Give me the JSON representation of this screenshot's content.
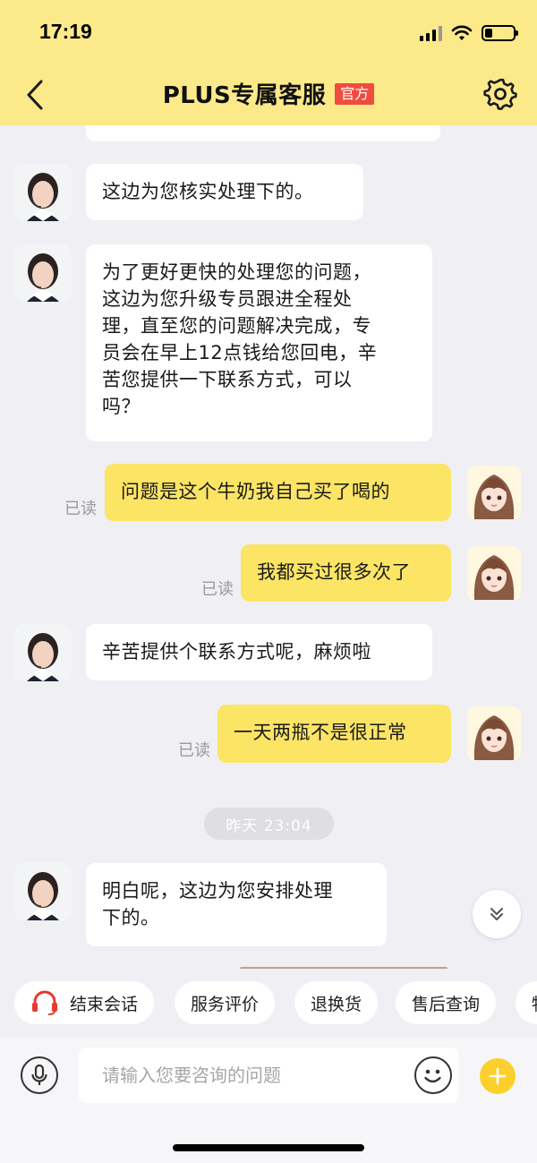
{
  "status_bar": {
    "time": "17:19"
  },
  "header": {
    "title": "PLUS专属客服",
    "badge": "官方"
  },
  "messages": [
    {
      "side": "agent",
      "text": "这边为您核实处理下的。"
    },
    {
      "side": "agent",
      "lines": [
        "为了更好更快的处理您的问题，",
        "这边为您升级专员跟进全程处",
        "理，直至您的问题解决完成，专",
        "员会在早上12点钱给您回电，辛",
        "苦您提供一下联系方式，可以",
        "吗？"
      ]
    },
    {
      "side": "user",
      "text": "问题是这个牛奶我自己买了喝的",
      "read": "已读"
    },
    {
      "side": "user",
      "text": "我都买过很多次了",
      "read": "已读"
    },
    {
      "side": "agent",
      "text": "辛苦提供个联系方式呢，麻烦啦"
    },
    {
      "side": "user",
      "text": "一天两瓶不是很正常",
      "read": "已读"
    },
    {
      "side": "agent",
      "lines": [
        "明白呢，这边为您安排处理",
        "下的。"
      ]
    }
  ],
  "timestamp": "昨天 23:04",
  "quick_actions": [
    "结束会话",
    "服务评价",
    "退换货",
    "售后查询",
    "物"
  ],
  "input": {
    "placeholder": "请输入您要咨询的问题"
  },
  "colors": {
    "header_bg": "#fce98a",
    "user_bubble": "#fce465",
    "badge": "#f04c3e",
    "plus": "#fccf2c",
    "headset": "#e8392e"
  },
  "icons": [
    "back-arrow-icon",
    "gear-icon",
    "scroll-down-icon",
    "headset-icon",
    "microphone-icon",
    "emoji-icon",
    "plus-icon"
  ]
}
